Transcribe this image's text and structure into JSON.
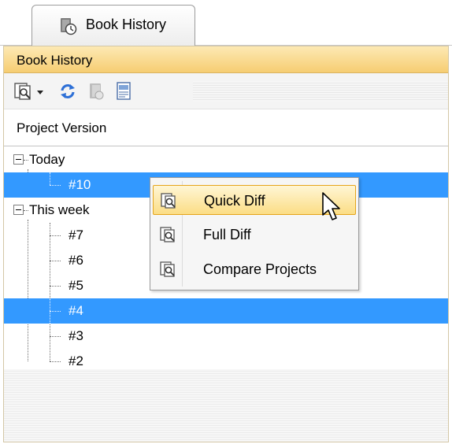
{
  "window_tab": {
    "label": "Book History",
    "icon": "book-history-icon"
  },
  "panel": {
    "title": "Book History"
  },
  "toolbar": {
    "buttons": [
      {
        "name": "diff-dropdown-button",
        "icon": "diff-icon"
      },
      {
        "name": "refresh-button",
        "icon": "refresh-icon"
      },
      {
        "name": "open-version-button",
        "icon": "book-icon"
      },
      {
        "name": "report-button",
        "icon": "report-icon"
      }
    ]
  },
  "column_header": {
    "label": "Project Version"
  },
  "tree": {
    "groups": [
      {
        "label": "Today",
        "expanded": true,
        "items": [
          {
            "label": "#10",
            "selected": true
          }
        ]
      },
      {
        "label": "This week",
        "expanded": true,
        "items": [
          {
            "label": "#7",
            "selected": false
          },
          {
            "label": "#6",
            "selected": false
          },
          {
            "label": "#5",
            "selected": false
          },
          {
            "label": "#4",
            "selected": true
          },
          {
            "label": "#3",
            "selected": false
          },
          {
            "label": "#2",
            "selected": false
          }
        ]
      }
    ]
  },
  "context_menu": {
    "items": [
      {
        "label": "Quick Diff",
        "icon": "diff-icon",
        "highlighted": true
      },
      {
        "label": "Full Diff",
        "icon": "diff-icon",
        "highlighted": false
      },
      {
        "label": "Compare Projects",
        "icon": "diff-icon",
        "highlighted": false
      }
    ]
  },
  "colors": {
    "selection": "#3399ff",
    "title_bar": "#f6cd72",
    "menu_highlight": "#fbdd85"
  }
}
